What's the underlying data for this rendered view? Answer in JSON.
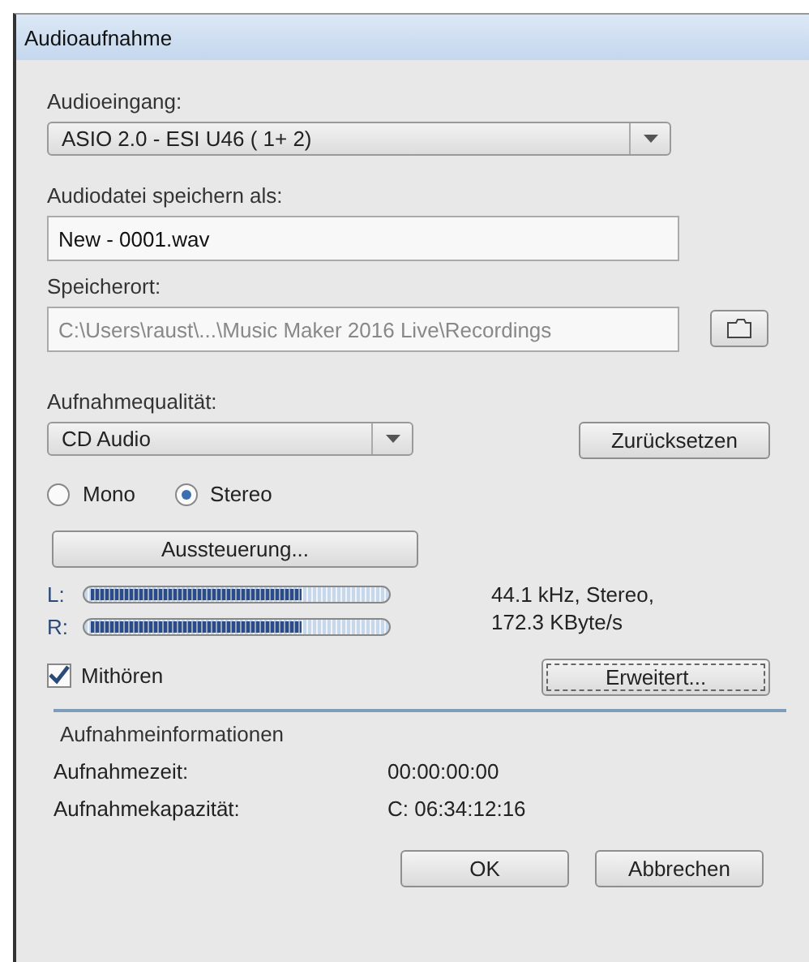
{
  "window": {
    "title": "Audioaufnahme"
  },
  "input": {
    "label": "Audioeingang:",
    "value": "ASIO 2.0 - ESI U46 ( 1+ 2)"
  },
  "file": {
    "label": "Audiodatei speichern als:",
    "value": "New - 0001.wav"
  },
  "location": {
    "label": "Speicherort:",
    "value": "C:\\Users\\raust\\...\\Music Maker 2016 Live\\Recordings",
    "disabled": true
  },
  "quality": {
    "label": "Aufnahmequalität:",
    "value": "CD Audio",
    "reset_button": "Zurücksetzen"
  },
  "channels": [
    {
      "label": "Mono",
      "selected": false
    },
    {
      "label": "Stereo",
      "selected": true
    }
  ],
  "level_button": "Aussteuerung...",
  "meters": [
    {
      "label": "L:",
      "level": 0.72
    },
    {
      "label": "R:",
      "level": 0.72
    }
  ],
  "format_info": [
    "44.1 kHz, Stereo,",
    "172.3 KByte/s"
  ],
  "monitor": {
    "label": "Mithören",
    "checked": true
  },
  "advanced_button": "Erweitert...",
  "info": {
    "title": "Aufnahmeinformationen",
    "rows": [
      {
        "label": "Aufnahmezeit:",
        "value": "00:00:00:00"
      },
      {
        "label": "Aufnahmekapazität:",
        "value": "C: 06:34:12:16"
      }
    ]
  },
  "buttons": [
    "OK",
    "Abbrechen"
  ]
}
